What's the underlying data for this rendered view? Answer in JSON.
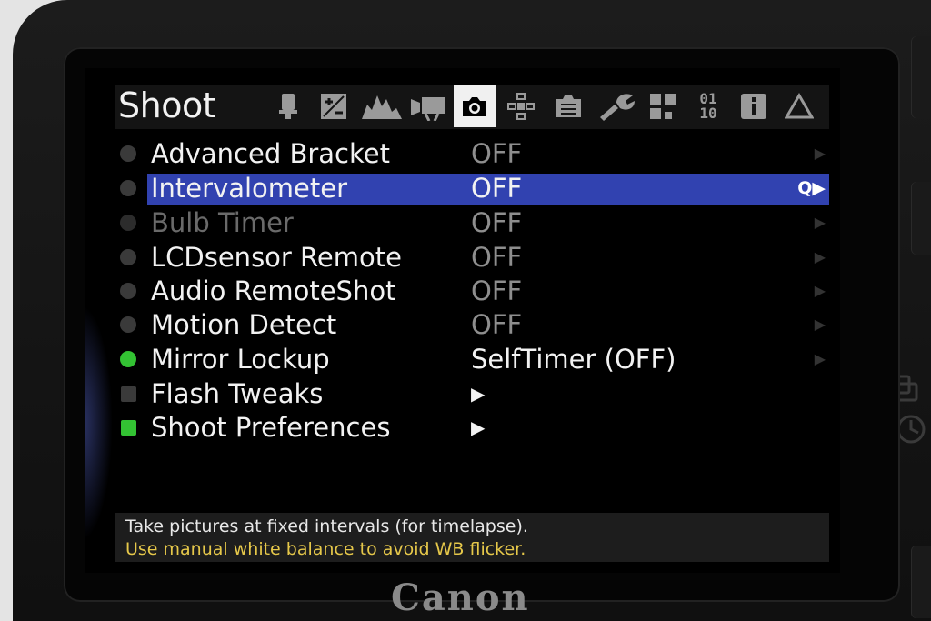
{
  "camera": {
    "brand": "Canon"
  },
  "header": {
    "title": "Shoot",
    "tabs": [
      {
        "name": "movie-icon",
        "active": false
      },
      {
        "name": "exposure-compensation-icon",
        "active": false
      },
      {
        "name": "histogram-icon",
        "active": false
      },
      {
        "name": "video-camera-icon",
        "active": false
      },
      {
        "name": "camera-icon",
        "active": true
      },
      {
        "name": "focus-icon",
        "active": false
      },
      {
        "name": "display-icon",
        "active": false
      },
      {
        "name": "wrench-icon",
        "active": false
      },
      {
        "name": "grid-icon",
        "active": false
      },
      {
        "name": "debug-icon",
        "label": "01\n10",
        "active": false
      },
      {
        "name": "info-icon",
        "active": false
      },
      {
        "name": "delta-icon",
        "active": false
      }
    ]
  },
  "menu": {
    "items": [
      {
        "label": "Advanced Bracket",
        "value": "OFF",
        "indicator": "dot",
        "indicator_color": "#3a3a3a"
      },
      {
        "label": "Intervalometer",
        "value": "OFF",
        "indicator": "dot",
        "indicator_color": "#3a3a3a",
        "selected": true,
        "q_label": "Q▶"
      },
      {
        "label": "Bulb Timer",
        "value": "OFF",
        "indicator": "dot",
        "indicator_color": "#2c2c2c",
        "dimmed": true
      },
      {
        "label": "LCDsensor Remote",
        "value": "OFF",
        "indicator": "dot",
        "indicator_color": "#3a3a3a"
      },
      {
        "label": "Audio RemoteShot",
        "value": "OFF",
        "indicator": "dot",
        "indicator_color": "#3a3a3a"
      },
      {
        "label": "Motion Detect",
        "value": "OFF",
        "indicator": "dot",
        "indicator_color": "#3a3a3a"
      },
      {
        "label": "Mirror Lockup",
        "value": "SelfTimer (OFF)",
        "indicator": "dot",
        "indicator_color": "#33c233"
      },
      {
        "label": "Flash Tweaks",
        "value": "▶",
        "indicator": "square",
        "indicator_color": "#3a3a3a"
      },
      {
        "label": "Shoot Preferences",
        "value": "▶",
        "indicator": "square",
        "indicator_color": "#33c233"
      }
    ]
  },
  "help": {
    "line1": "Take pictures at fixed intervals (for timelapse).",
    "line2": "Use manual white balance to avoid WB flicker."
  },
  "colors": {
    "selection": "#3142b0",
    "help_warning": "#e6c84a",
    "active_green": "#33c233"
  }
}
